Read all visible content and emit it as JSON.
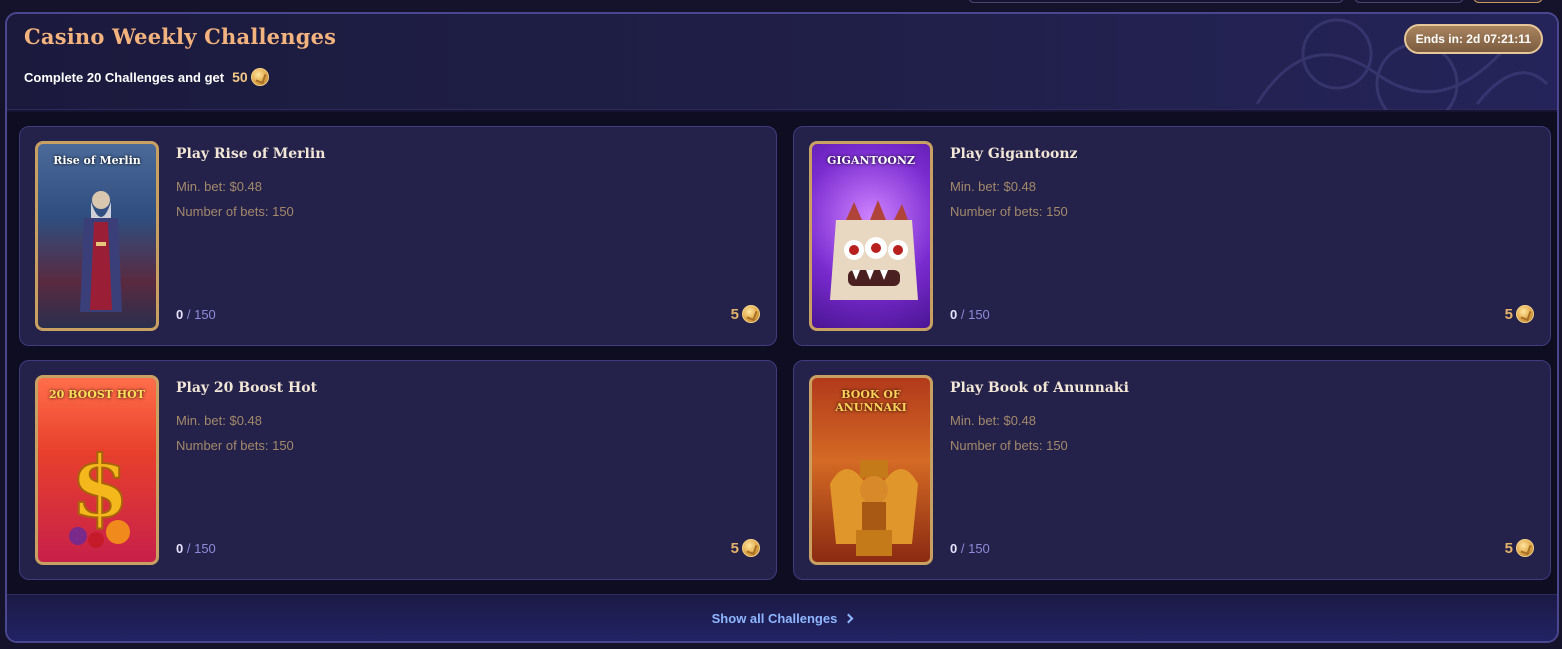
{
  "header": {
    "title": "Casino Weekly Challenges",
    "subtitle": "Complete 20 Challenges and get",
    "reward_amount": "50",
    "ends_label": "Ends in: 2d 07:21:11"
  },
  "challenges": [
    {
      "title": "Play Rise of Merlin",
      "thumb_label": "Rise of Merlin",
      "min_bet": "Min. bet: $0.48",
      "num_bets": "Number of bets: 150",
      "progress_current": "0",
      "progress_total": "/ 150",
      "reward": "5"
    },
    {
      "title": "Play Gigantoonz",
      "thumb_label": "GIGANTOONZ",
      "min_bet": "Min. bet: $0.48",
      "num_bets": "Number of bets: 150",
      "progress_current": "0",
      "progress_total": "/ 150",
      "reward": "5"
    },
    {
      "title": "Play 20 Boost Hot",
      "thumb_label": "20 BOOST HOT",
      "min_bet": "Min. bet: $0.48",
      "num_bets": "Number of bets: 150",
      "progress_current": "0",
      "progress_total": "/ 150",
      "reward": "5"
    },
    {
      "title": "Play Book of Anunnaki",
      "thumb_label": "BOOK OF ANUNNAKI",
      "min_bet": "Min. bet: $0.48",
      "num_bets": "Number of bets: 150",
      "progress_current": "0",
      "progress_total": "/ 150",
      "reward": "5"
    }
  ],
  "footer": {
    "show_all_label": "Show all Challenges"
  },
  "colors": {
    "title": "#f3b37e",
    "accent_gold": "#e2b368",
    "link": "#8fb7ff",
    "card_bg": "#24214a",
    "border": "#4b4690"
  }
}
